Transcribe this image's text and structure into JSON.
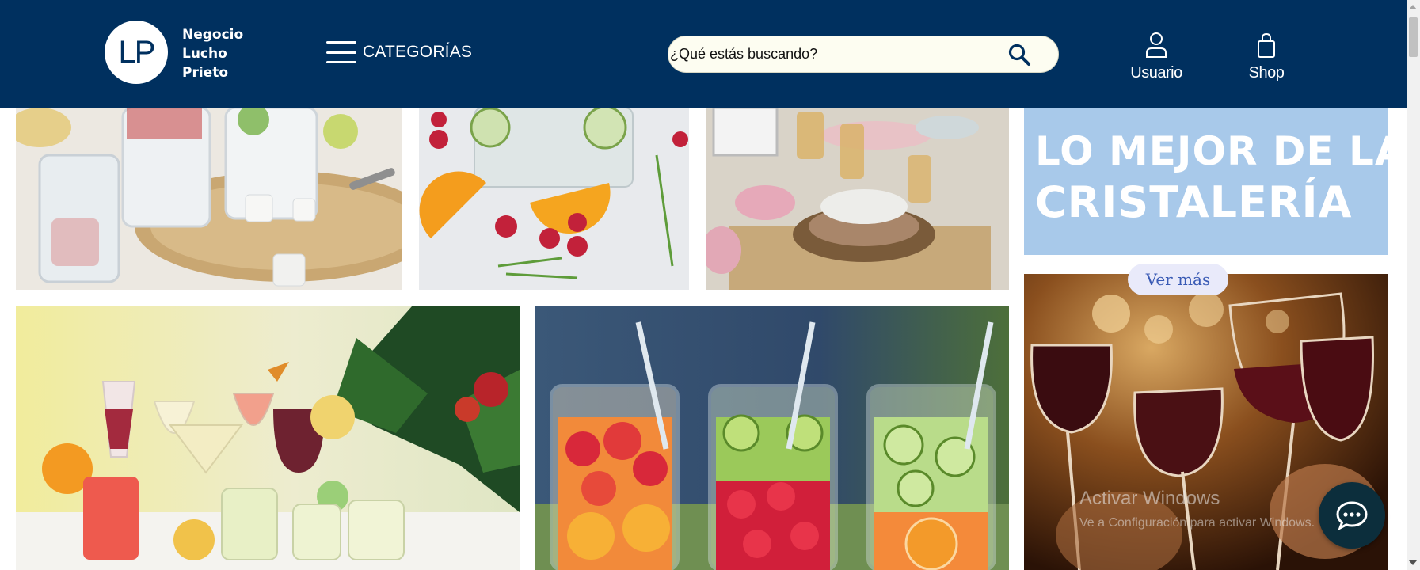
{
  "header": {
    "logo_initials": "LP",
    "brand_lines": [
      "Negocio",
      "Lucho",
      "Prieto"
    ],
    "categories_label": "CATEGORÍAS",
    "search_placeholder": "¿Qué estás buscando?",
    "user_label": "Usuario",
    "shop_label": "Shop",
    "icons": {
      "menu": "hamburger-menu-icon",
      "search": "search-icon",
      "user": "user-icon",
      "shop": "shopping-bag-icon"
    }
  },
  "promo": {
    "banner_line1": "LO MEJOR DE LA",
    "banner_line2": "CRISTALERÍA",
    "ver_mas_label": "Ver más"
  },
  "gallery": {
    "tiles": [
      "glasses-tray",
      "citrus-water",
      "table-setting",
      "cocktails",
      "fruit-water-jars",
      "wine-toast"
    ]
  },
  "watermark": {
    "title": "Activar Windows",
    "subtitle": "Ve a Configuración para activar Windows."
  },
  "chat": {
    "icon": "chat-bubble-icon"
  },
  "colors": {
    "header_bg": "#00305f",
    "banner_bg": "#a8c9ea",
    "search_bg": "#fdfdf1",
    "ver_mas_text": "#3a5bb5",
    "chat_bg": "#0c2e3c"
  }
}
